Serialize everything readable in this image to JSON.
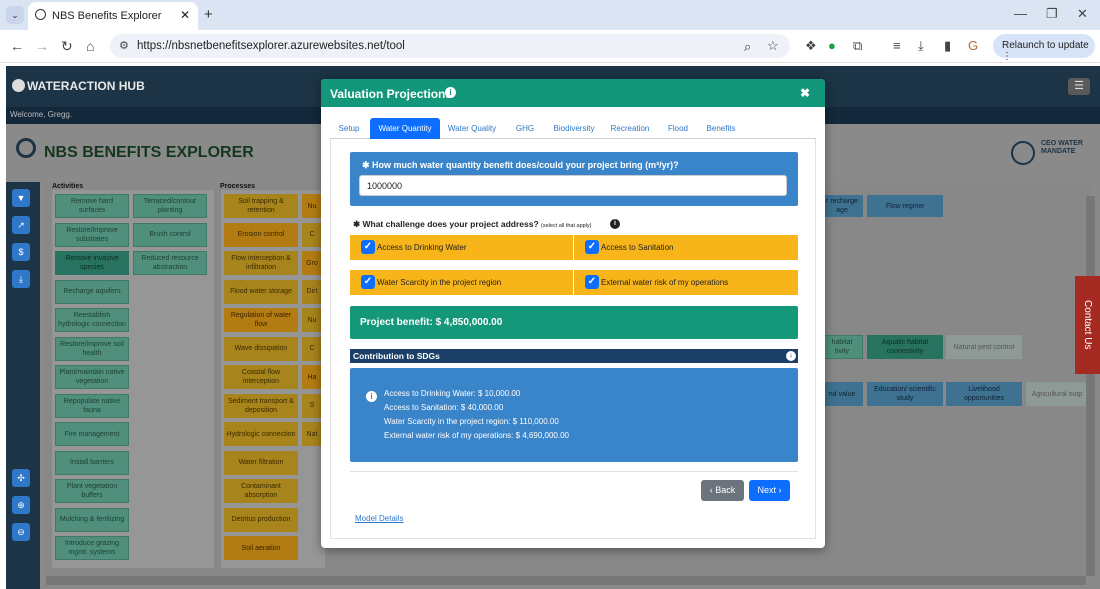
{
  "browser": {
    "tab_title": "NBS Benefits Explorer",
    "new_tab": "+",
    "tab_close": "✕",
    "url": "https://nbsnetbenefitsexplorer.azurewebsites.net/tool",
    "relaunch": "Relaunch to update",
    "profile_initial": "G"
  },
  "app": {
    "logo": "WATERACTION HUB",
    "welcome": "Welcome, Gregg.",
    "title": "NBS BENEFITS EXPLORER",
    "ceo_logo": "CEO WATER MANDATE",
    "contact": "Contact Us",
    "columns": {
      "activities": "Activities",
      "processes": "Processes"
    },
    "activities_col1": [
      "Remove hard surfaces",
      "Restore/improve substrates",
      "Remove invasive species",
      "Recharge aquifers",
      "Reestablish hydrologic connection",
      "Restore/improve soil health",
      "Plant/maintain native vegetation",
      "Repopulate native fauna",
      "Fire management",
      "Install barriers",
      "Plant vegetation buffers",
      "Mulching & fertilizing",
      "Introduce grazing mgmt. systems"
    ],
    "activities_col2": [
      "Terraced/contour planting",
      "Brush control",
      "Reduced resource abstraction"
    ],
    "processes_col1": [
      "Soil trapping & retention",
      "Erosion control",
      "Flow interception & infiltration",
      "Flood water storage",
      "Regulation of water flow",
      "Wave dissipation",
      "Coastal flow interception",
      "Sediment transport & deposition",
      "Hydrologic connection",
      "Water filtration",
      "Contaminant absorption",
      "Detritus production",
      "Soil aeration"
    ],
    "processes_col2": [
      "Nu",
      "C",
      "Gro",
      "Dirt",
      "Nu",
      "C",
      "Ha",
      "S",
      "Nat"
    ],
    "right_cells": {
      "recharge": "r recharge age",
      "flow_regime": "Flow regime",
      "habitat": "habitat tivity",
      "aquatic": "Aquatic habitat connectivity",
      "natural_pest": "Natural pest control",
      "land_value": "nd value",
      "education": "Education/ scientific study",
      "livelihood": "Livelihood opportunities",
      "agricultural": "Agricultural outp"
    }
  },
  "modal": {
    "title": "Valuation Projections",
    "close": "✖",
    "info": "i",
    "tabs": [
      "Setup",
      "Water Quantity",
      "Water Quality",
      "GHG",
      "Biodiversity",
      "Recreation",
      "Flood",
      "Benefits"
    ],
    "active_tab": "Water Quantity",
    "question": "How much water quantity benefit does/could your project bring (m³/yr)?",
    "question_value": "1000000",
    "challenge_label": "What challenge does your project address?",
    "challenge_hint": "(select all that apply)",
    "challenges": [
      "Access to Drinking Water",
      "Access to Sanitation",
      "Water Scarcity in the project region",
      "External water risk of my operations"
    ],
    "benefit": "Project benefit: $ 4,850,000.00",
    "sdg_title": "Contribution to SDGs",
    "sdg_lines": [
      "Access to Drinking Water: $ 10,000.00",
      "Access to Sanitation: $ 40,000.00",
      "Water Scarcity in the project region: $ 110,000.00",
      "External water risk of my operations: $ 4,690,000.00"
    ],
    "back": "‹ Back",
    "next": "Next ›",
    "model_details": "Model Details"
  }
}
